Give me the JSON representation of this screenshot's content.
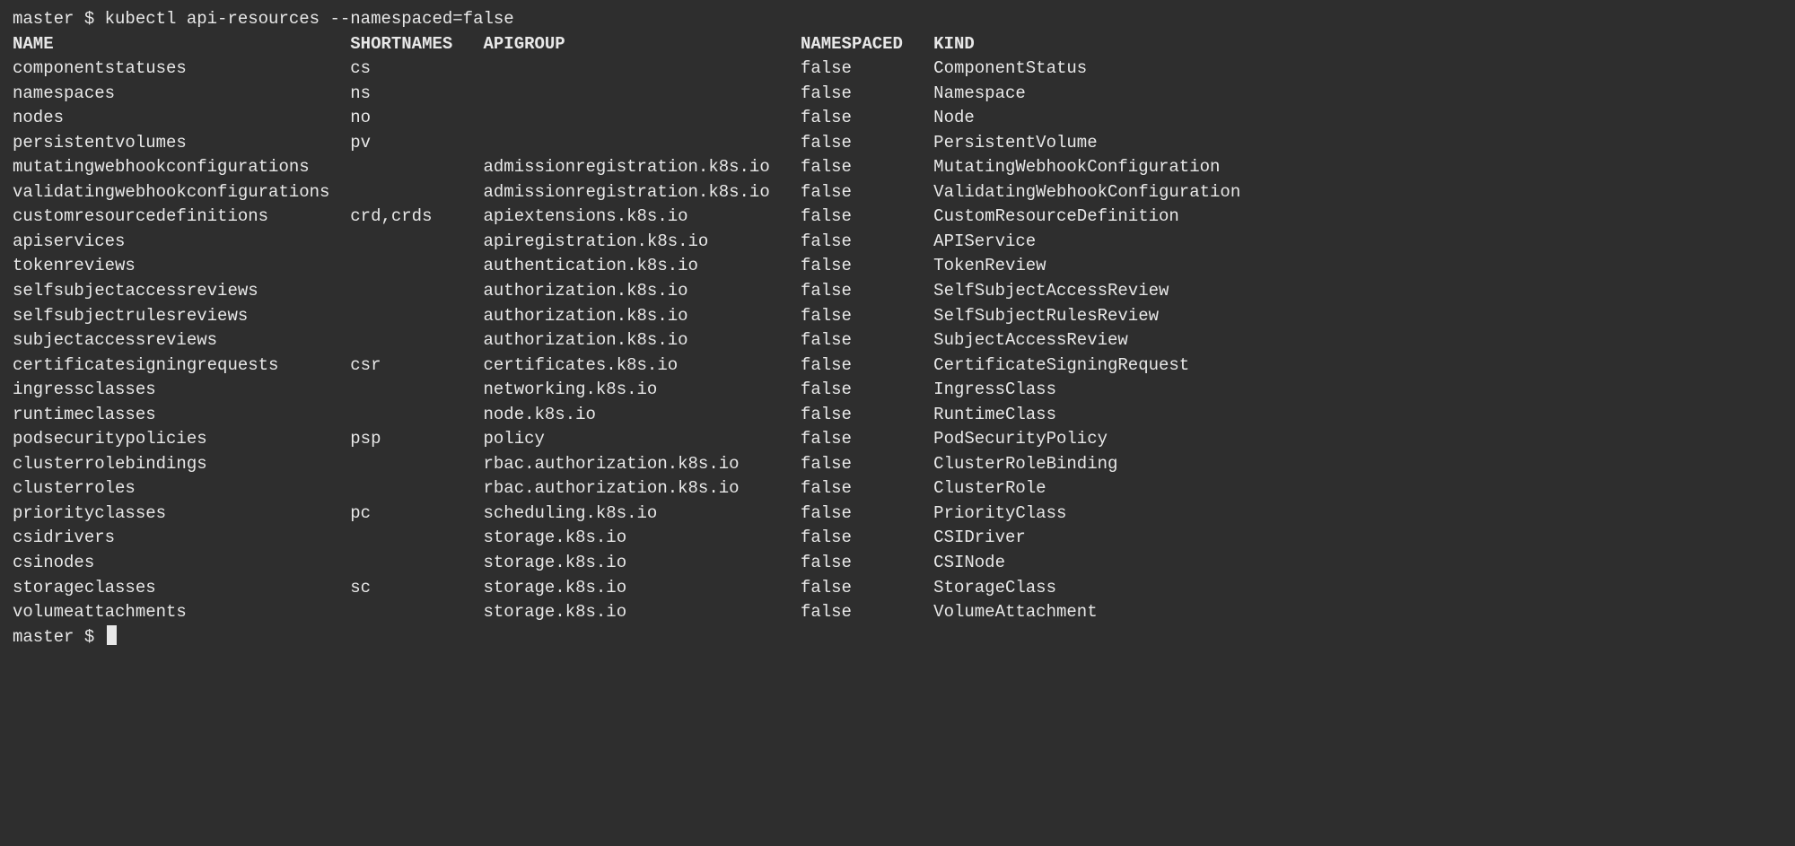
{
  "prompt1": "master $ kubectl api-resources --namespaced=false",
  "prompt2": "master $ ",
  "columns": [
    {
      "key": "name",
      "label": "NAME",
      "width": 33
    },
    {
      "key": "shortnames",
      "label": "SHORTNAMES",
      "width": 13
    },
    {
      "key": "apigroup",
      "label": "APIGROUP",
      "width": 31
    },
    {
      "key": "namespaced",
      "label": "NAMESPACED",
      "width": 13
    },
    {
      "key": "kind",
      "label": "KIND",
      "width": 0
    }
  ],
  "rows": [
    {
      "name": "componentstatuses",
      "shortnames": "cs",
      "apigroup": "",
      "namespaced": "false",
      "kind": "ComponentStatus"
    },
    {
      "name": "namespaces",
      "shortnames": "ns",
      "apigroup": "",
      "namespaced": "false",
      "kind": "Namespace"
    },
    {
      "name": "nodes",
      "shortnames": "no",
      "apigroup": "",
      "namespaced": "false",
      "kind": "Node"
    },
    {
      "name": "persistentvolumes",
      "shortnames": "pv",
      "apigroup": "",
      "namespaced": "false",
      "kind": "PersistentVolume"
    },
    {
      "name": "mutatingwebhookconfigurations",
      "shortnames": "",
      "apigroup": "admissionregistration.k8s.io",
      "namespaced": "false",
      "kind": "MutatingWebhookConfiguration"
    },
    {
      "name": "validatingwebhookconfigurations",
      "shortnames": "",
      "apigroup": "admissionregistration.k8s.io",
      "namespaced": "false",
      "kind": "ValidatingWebhookConfiguration"
    },
    {
      "name": "customresourcedefinitions",
      "shortnames": "crd,crds",
      "apigroup": "apiextensions.k8s.io",
      "namespaced": "false",
      "kind": "CustomResourceDefinition"
    },
    {
      "name": "apiservices",
      "shortnames": "",
      "apigroup": "apiregistration.k8s.io",
      "namespaced": "false",
      "kind": "APIService"
    },
    {
      "name": "tokenreviews",
      "shortnames": "",
      "apigroup": "authentication.k8s.io",
      "namespaced": "false",
      "kind": "TokenReview"
    },
    {
      "name": "selfsubjectaccessreviews",
      "shortnames": "",
      "apigroup": "authorization.k8s.io",
      "namespaced": "false",
      "kind": "SelfSubjectAccessReview"
    },
    {
      "name": "selfsubjectrulesreviews",
      "shortnames": "",
      "apigroup": "authorization.k8s.io",
      "namespaced": "false",
      "kind": "SelfSubjectRulesReview"
    },
    {
      "name": "subjectaccessreviews",
      "shortnames": "",
      "apigroup": "authorization.k8s.io",
      "namespaced": "false",
      "kind": "SubjectAccessReview"
    },
    {
      "name": "certificatesigningrequests",
      "shortnames": "csr",
      "apigroup": "certificates.k8s.io",
      "namespaced": "false",
      "kind": "CertificateSigningRequest"
    },
    {
      "name": "ingressclasses",
      "shortnames": "",
      "apigroup": "networking.k8s.io",
      "namespaced": "false",
      "kind": "IngressClass"
    },
    {
      "name": "runtimeclasses",
      "shortnames": "",
      "apigroup": "node.k8s.io",
      "namespaced": "false",
      "kind": "RuntimeClass"
    },
    {
      "name": "podsecuritypolicies",
      "shortnames": "psp",
      "apigroup": "policy",
      "namespaced": "false",
      "kind": "PodSecurityPolicy"
    },
    {
      "name": "clusterrolebindings",
      "shortnames": "",
      "apigroup": "rbac.authorization.k8s.io",
      "namespaced": "false",
      "kind": "ClusterRoleBinding"
    },
    {
      "name": "clusterroles",
      "shortnames": "",
      "apigroup": "rbac.authorization.k8s.io",
      "namespaced": "false",
      "kind": "ClusterRole"
    },
    {
      "name": "priorityclasses",
      "shortnames": "pc",
      "apigroup": "scheduling.k8s.io",
      "namespaced": "false",
      "kind": "PriorityClass"
    },
    {
      "name": "csidrivers",
      "shortnames": "",
      "apigroup": "storage.k8s.io",
      "namespaced": "false",
      "kind": "CSIDriver"
    },
    {
      "name": "csinodes",
      "shortnames": "",
      "apigroup": "storage.k8s.io",
      "namespaced": "false",
      "kind": "CSINode"
    },
    {
      "name": "storageclasses",
      "shortnames": "sc",
      "apigroup": "storage.k8s.io",
      "namespaced": "false",
      "kind": "StorageClass"
    },
    {
      "name": "volumeattachments",
      "shortnames": "",
      "apigroup": "storage.k8s.io",
      "namespaced": "false",
      "kind": "VolumeAttachment"
    }
  ]
}
